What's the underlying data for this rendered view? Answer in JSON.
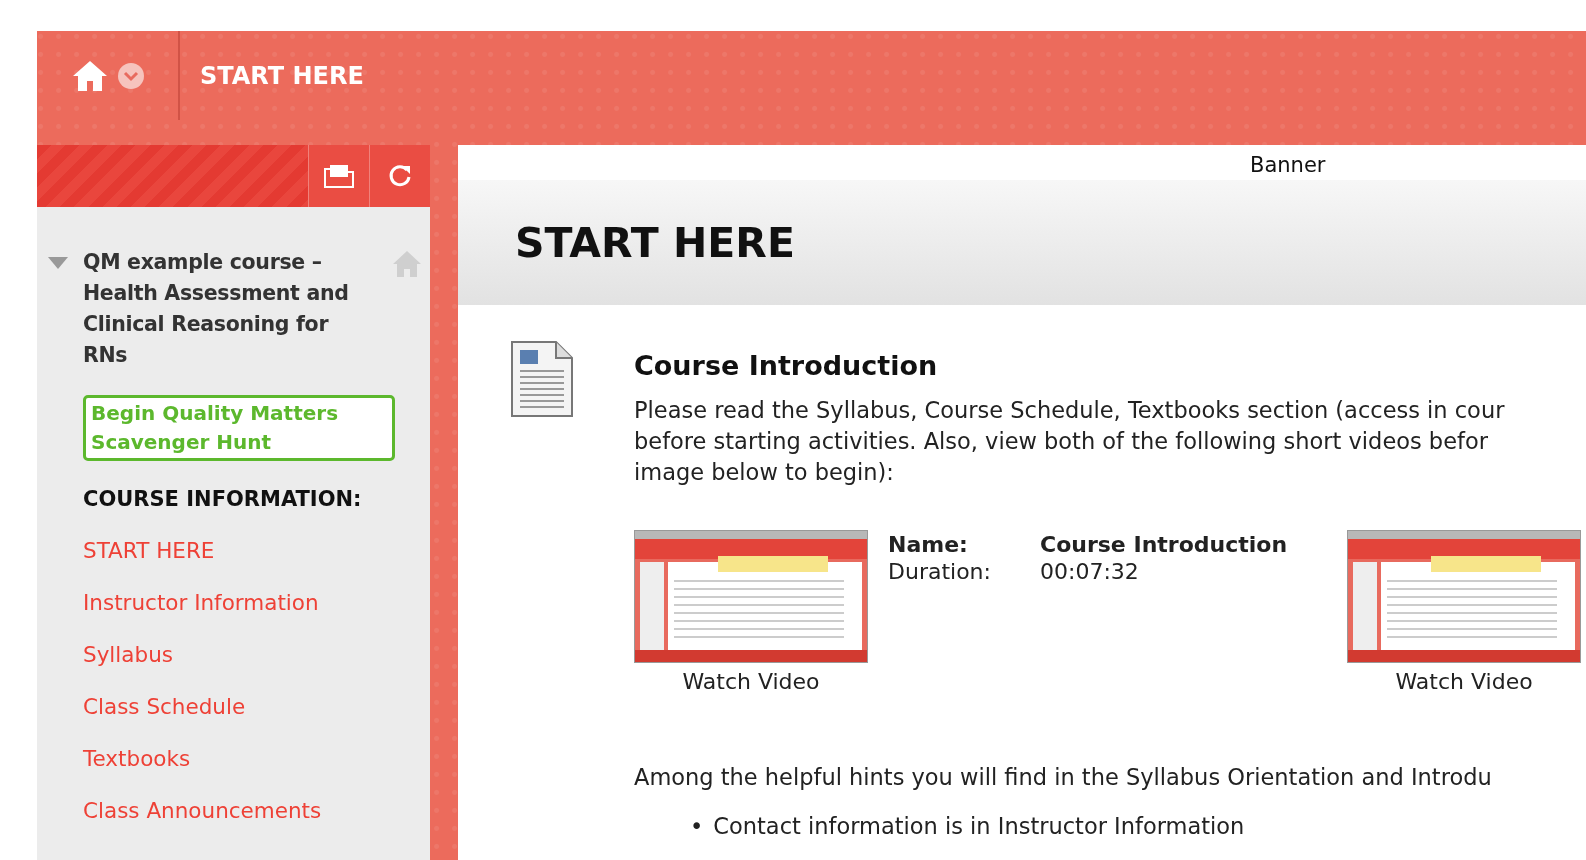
{
  "top_bar": {
    "title": "START HERE"
  },
  "sidebar": {
    "course_title": "QM example course – Health Assessment and Clinical Reasoning for RNs",
    "expanded": true,
    "highlight_button": "Begin Quality Matters Scavenger Hunt",
    "section_heading": "COURSE INFORMATION:",
    "links": [
      "START HERE",
      "Instructor Information",
      "Syllabus",
      "Class Schedule",
      "Textbooks",
      "Class Announcements"
    ]
  },
  "content": {
    "banner": "Banner",
    "page_title": "START HERE",
    "item": {
      "title": "Course Introduction",
      "paragraph_lines": [
        "Please read the Syllabus, Course Schedule, Textbooks section (access in cour",
        "before starting activities. Also, view both of the following short videos befor",
        "image below to begin):"
      ],
      "videos": [
        {
          "caption": "Watch Video",
          "details": [
            {
              "label": "Name:",
              "value": "Course Introduction",
              "bold": true
            },
            {
              "label": "Duration:",
              "value": "00:07:32",
              "bold": false
            }
          ]
        },
        {
          "caption": "Watch Video"
        }
      ],
      "hint": "Among the helpful hints you will find in the Syllabus Orientation and Introdu",
      "bullets": [
        {
          "marker": "•",
          "text": "Contact information is in Instructor Information"
        }
      ]
    }
  }
}
